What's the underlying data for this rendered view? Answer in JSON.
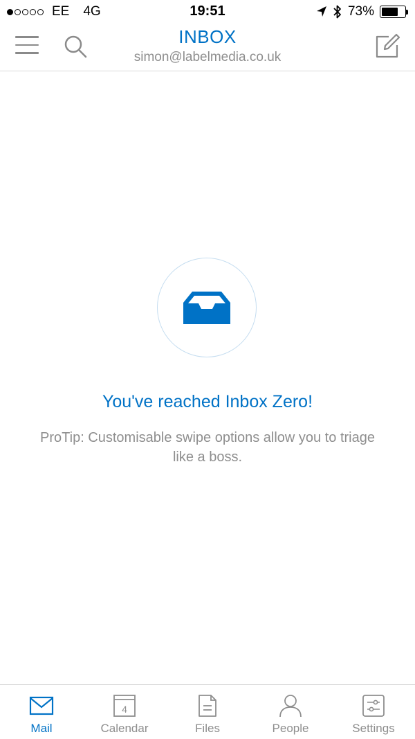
{
  "status_bar": {
    "signal_filled": 1,
    "signal_total": 5,
    "carrier": "EE",
    "network": "4G",
    "time": "19:51",
    "battery_percent": "73%",
    "battery_level": 0.73,
    "icons": [
      "location-arrow-icon",
      "bluetooth-icon",
      "battery-icon"
    ]
  },
  "header": {
    "title": "INBOX",
    "account": "simon@labelmedia.co.uk",
    "icons": [
      "hamburger-menu-icon",
      "search-icon",
      "compose-icon"
    ]
  },
  "empty_state": {
    "icon": "inbox-tray-icon",
    "title": "You've reached Inbox Zero!",
    "tip": "ProTip: Customisable swipe options allow you to triage like a boss."
  },
  "tabs": [
    {
      "label": "Mail",
      "icon": "mail-icon",
      "active": true
    },
    {
      "label": "Calendar",
      "icon": "calendar-icon",
      "day": "4",
      "active": false
    },
    {
      "label": "Files",
      "icon": "file-icon",
      "active": false
    },
    {
      "label": "People",
      "icon": "person-icon",
      "active": false
    },
    {
      "label": "Settings",
      "icon": "settings-sliders-icon",
      "active": false
    }
  ],
  "colors": {
    "accent": "#0072c6",
    "muted_text": "#8e8e8e",
    "divider": "#d8d8d8",
    "circle_border": "#c5ddf0"
  }
}
